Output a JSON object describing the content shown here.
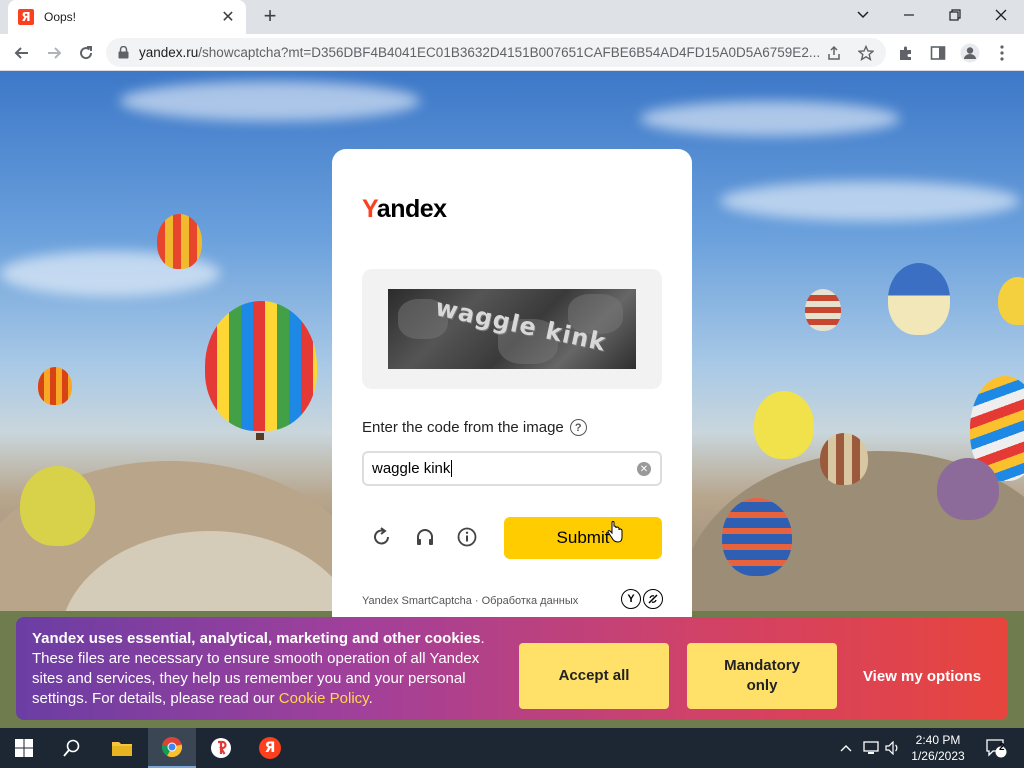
{
  "browser": {
    "tab_title": "Oops!",
    "favicon_letter": "Я",
    "new_tab": "+",
    "url_host": "yandex.ru",
    "url_path": "/showcaptcha?mt=D356DBF4B4041EC01B3632D4151B007651CAFBE6B54AD4FD15A0D5A6759E2..."
  },
  "captcha": {
    "logo_first": "Y",
    "logo_rest": "andex",
    "image_text": "waggle kink",
    "prompt": "Enter the code from the image",
    "help": "?",
    "input_value": "waggle kink",
    "submit_label": "Submit",
    "footer_text": "Yandex SmartCaptcha · Обработка данных",
    "footer_logo_1": "Y"
  },
  "cookie_banner": {
    "title": "Yandex uses essential, analytical, marketing and other cookies",
    "title_end": ".",
    "body": " These files are necessary to ensure smooth operation of all Yandex sites and services, they help us remember you and your personal settings. For details, please read our ",
    "link": "Cookie Policy",
    "end": ".",
    "accept_all": "Accept all",
    "mandatory_only": "Mandatory only",
    "view_options": "View my options"
  },
  "taskbar": {
    "time": "2:40 PM",
    "date": "1/26/2023",
    "notifications": "2",
    "yandex_letter": "Я"
  },
  "colors": {
    "yandex_red": "#fc3f1d",
    "submit_yellow": "#ffcc00",
    "cookie_button": "#ffe169"
  }
}
